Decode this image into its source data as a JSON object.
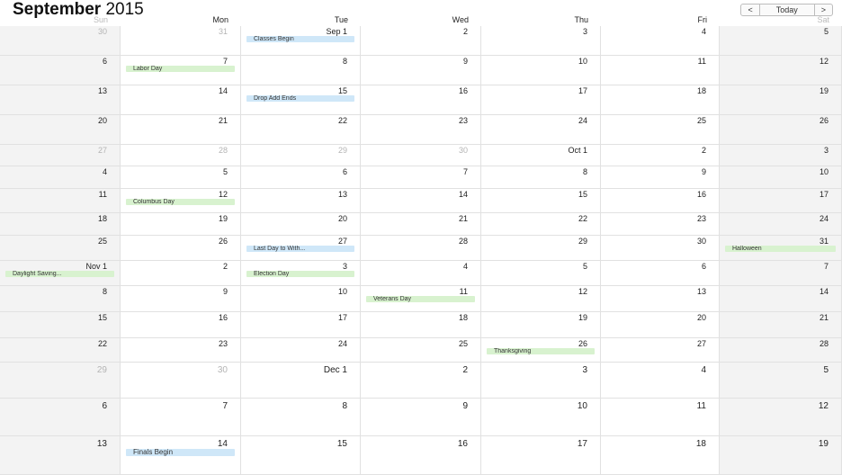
{
  "header": {
    "month": "September",
    "year": "2015",
    "prev_label": "<",
    "today_label": "Today",
    "next_label": ">"
  },
  "weekdays": [
    "Sun",
    "Mon",
    "Tue",
    "Wed",
    "Thu",
    "Fri",
    "Sat"
  ],
  "weeks": [
    [
      {
        "n": "30",
        "o": true
      },
      {
        "n": "31",
        "o": true
      },
      {
        "n": "Sep 1",
        "ev": "Classes Begin",
        "c": "blue"
      },
      {
        "n": "2"
      },
      {
        "n": "3"
      },
      {
        "n": "4"
      },
      {
        "n": "5"
      }
    ],
    [
      {
        "n": "6"
      },
      {
        "n": "7",
        "ev": "Labor Day",
        "c": "green"
      },
      {
        "n": "8"
      },
      {
        "n": "9"
      },
      {
        "n": "10"
      },
      {
        "n": "11"
      },
      {
        "n": "12"
      }
    ],
    [
      {
        "n": "13"
      },
      {
        "n": "14"
      },
      {
        "n": "15",
        "ev": "Drop Add Ends",
        "c": "blue"
      },
      {
        "n": "16"
      },
      {
        "n": "17"
      },
      {
        "n": "18"
      },
      {
        "n": "19"
      }
    ],
    [
      {
        "n": "20"
      },
      {
        "n": "21"
      },
      {
        "n": "22"
      },
      {
        "n": "23"
      },
      {
        "n": "24"
      },
      {
        "n": "25"
      },
      {
        "n": "26"
      }
    ],
    [
      {
        "n": "27",
        "o": true
      },
      {
        "n": "28",
        "o": true
      },
      {
        "n": "29",
        "o": true
      },
      {
        "n": "30",
        "o": true
      },
      {
        "n": "Oct 1"
      },
      {
        "n": "2"
      },
      {
        "n": "3"
      }
    ],
    [
      {
        "n": "4"
      },
      {
        "n": "5"
      },
      {
        "n": "6"
      },
      {
        "n": "7"
      },
      {
        "n": "8"
      },
      {
        "n": "9"
      },
      {
        "n": "10"
      }
    ],
    [
      {
        "n": "11"
      },
      {
        "n": "12",
        "ev": "Columbus Day",
        "c": "green"
      },
      {
        "n": "13"
      },
      {
        "n": "14"
      },
      {
        "n": "15"
      },
      {
        "n": "16"
      },
      {
        "n": "17"
      }
    ],
    [
      {
        "n": "18"
      },
      {
        "n": "19"
      },
      {
        "n": "20"
      },
      {
        "n": "21"
      },
      {
        "n": "22"
      },
      {
        "n": "23"
      },
      {
        "n": "24"
      }
    ],
    [
      {
        "n": "25"
      },
      {
        "n": "26"
      },
      {
        "n": "27",
        "ev": "Last Day to With...",
        "c": "blue"
      },
      {
        "n": "28"
      },
      {
        "n": "29"
      },
      {
        "n": "30"
      },
      {
        "n": "31",
        "ev": "Halloween",
        "c": "green"
      }
    ],
    [
      {
        "n": "Nov 1",
        "ev": "Daylight Saving...",
        "c": "green"
      },
      {
        "n": "2"
      },
      {
        "n": "3",
        "ev": "Election Day",
        "c": "green"
      },
      {
        "n": "4"
      },
      {
        "n": "5"
      },
      {
        "n": "6"
      },
      {
        "n": "7"
      }
    ],
    [
      {
        "n": "8"
      },
      {
        "n": "9"
      },
      {
        "n": "10"
      },
      {
        "n": "11",
        "ev": "Veterans Day",
        "c": "green"
      },
      {
        "n": "12"
      },
      {
        "n": "13"
      },
      {
        "n": "14"
      }
    ],
    [
      {
        "n": "15"
      },
      {
        "n": "16"
      },
      {
        "n": "17"
      },
      {
        "n": "18"
      },
      {
        "n": "19"
      },
      {
        "n": "20"
      },
      {
        "n": "21"
      }
    ],
    [
      {
        "n": "22"
      },
      {
        "n": "23"
      },
      {
        "n": "24"
      },
      {
        "n": "25"
      },
      {
        "n": "26",
        "ev": "Thanksgiving",
        "c": "green"
      },
      {
        "n": "27"
      },
      {
        "n": "28"
      }
    ],
    [
      {
        "n": "29",
        "o": true
      },
      {
        "n": "30",
        "o": true
      },
      {
        "n": "Dec 1"
      },
      {
        "n": "2"
      },
      {
        "n": "3"
      },
      {
        "n": "4"
      },
      {
        "n": "5"
      }
    ],
    [
      {
        "n": "6"
      },
      {
        "n": "7"
      },
      {
        "n": "8"
      },
      {
        "n": "9"
      },
      {
        "n": "10"
      },
      {
        "n": "11"
      },
      {
        "n": "12"
      }
    ],
    [
      {
        "n": "13"
      },
      {
        "n": "14",
        "ev": "Finals Begin",
        "c": "blue"
      },
      {
        "n": "15"
      },
      {
        "n": "16"
      },
      {
        "n": "17"
      },
      {
        "n": "18"
      },
      {
        "n": "19"
      }
    ]
  ]
}
